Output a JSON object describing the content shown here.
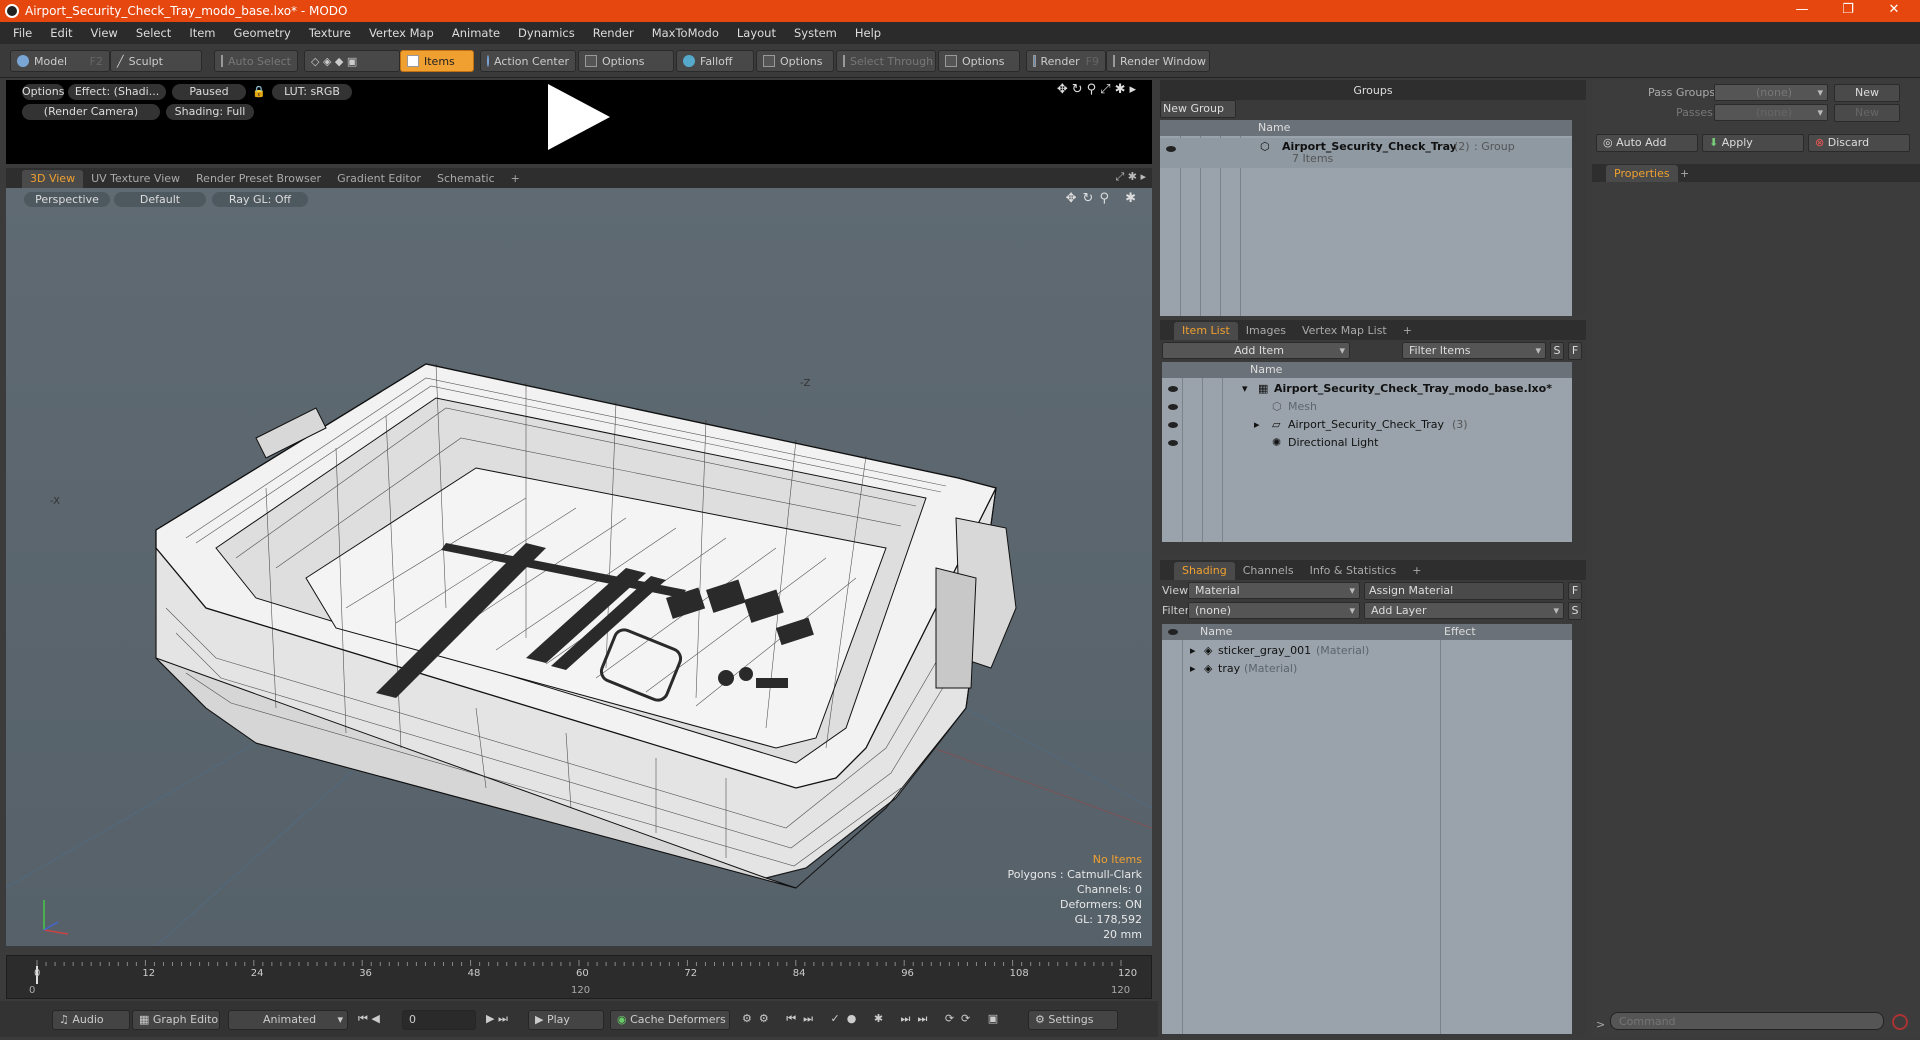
{
  "window": {
    "title": "Airport_Security_Check_Tray_modo_base.lxo* - MODO",
    "min": "—",
    "max": "❐",
    "close": "✕"
  },
  "menu": [
    "File",
    "Edit",
    "View",
    "Select",
    "Item",
    "Geometry",
    "Texture",
    "Vertex Map",
    "Animate",
    "Dynamics",
    "Render",
    "MaxToModo",
    "Layout",
    "System",
    "Help"
  ],
  "toolbar": {
    "model": "Model",
    "model_key": "F2",
    "sculpt": "Sculpt",
    "auto_select": "Auto Select",
    "items": "Items",
    "action_center": "Action Center",
    "options1": "Options",
    "falloff": "Falloff",
    "options2": "Options",
    "select_through": "Select Through",
    "options3": "Options",
    "render": "Render",
    "render_key": "F9",
    "render_window": "Render Window"
  },
  "preview": {
    "options": "Options",
    "effect": "Effect: (Shadi...",
    "paused": "Paused",
    "lut": "LUT: sRGB",
    "camera": "(Render Camera)",
    "shading": "Shading: Full"
  },
  "viewtabs": [
    "3D View",
    "UV Texture View",
    "Render Preset Browser",
    "Gradient Editor",
    "Schematic",
    "+"
  ],
  "viewport": {
    "perspective": "Perspective",
    "default": "Default",
    "raygl": "Ray GL: Off",
    "axis_z": "-Z",
    "axis_x": "-X"
  },
  "stats": {
    "no_items": "No Items",
    "polygons": "Polygons : Catmull-Clark",
    "channels": "Channels: 0",
    "deformers": "Deformers: ON",
    "gl": "GL: 178,592",
    "size": "20 mm"
  },
  "timeline": {
    "ticks": [
      "0",
      "12",
      "24",
      "36",
      "48",
      "60",
      "72",
      "84",
      "96",
      "108",
      "120"
    ],
    "bottom_left": "0",
    "bottom_mid": "120",
    "bottom_right": "120"
  },
  "bottom": {
    "audio": "Audio",
    "graph_editor": "Graph Editor",
    "animated": "Animated",
    "frame": "0",
    "play": "Play",
    "cache": "Cache Deformers",
    "settings": "Settings"
  },
  "groups": {
    "title": "Groups",
    "new_group": "New Group",
    "col_name": "Name",
    "item_name": "Airport_Security_Check_Tray",
    "item_count": "(2)",
    "item_type": ": Group",
    "item_sub": "7 Items"
  },
  "itemlist": {
    "tabs": [
      "Item List",
      "Images",
      "Vertex Map List",
      "+"
    ],
    "add_item": "Add Item",
    "filter": "Filter Items",
    "s": "S",
    "f": "F",
    "col_name": "Name",
    "rows": [
      {
        "label": "Airport_Security_Check_Tray_modo_base.lxo*",
        "extra": ""
      },
      {
        "label": "Mesh",
        "extra": ""
      },
      {
        "label": "Airport_Security_Check_Tray",
        "extra": "(3)"
      },
      {
        "label": "Directional Light",
        "extra": ""
      }
    ]
  },
  "shading": {
    "tabs": [
      "Shading",
      "Channels",
      "Info & Statistics",
      "+"
    ],
    "view_label": "View",
    "view_value": "Material",
    "assign": "Assign Material",
    "f": "F",
    "filter_label": "Filter",
    "filter_value": "(none)",
    "add_layer": "Add Layer",
    "s": "S",
    "col_name": "Name",
    "col_effect": "Effect",
    "rows": [
      {
        "name": "sticker_gray_001",
        "type": "(Material)"
      },
      {
        "name": "tray",
        "type": "(Material)"
      }
    ]
  },
  "passes": {
    "pass_groups": "Pass Groups",
    "passes": "Passes",
    "none": "(none)",
    "new": "New",
    "auto_add": "Auto Add",
    "apply": "Apply",
    "discard": "Discard"
  },
  "properties": {
    "tab": "Properties",
    "plus": "+"
  },
  "command": {
    "placeholder": "Command",
    "arrow": ">"
  }
}
